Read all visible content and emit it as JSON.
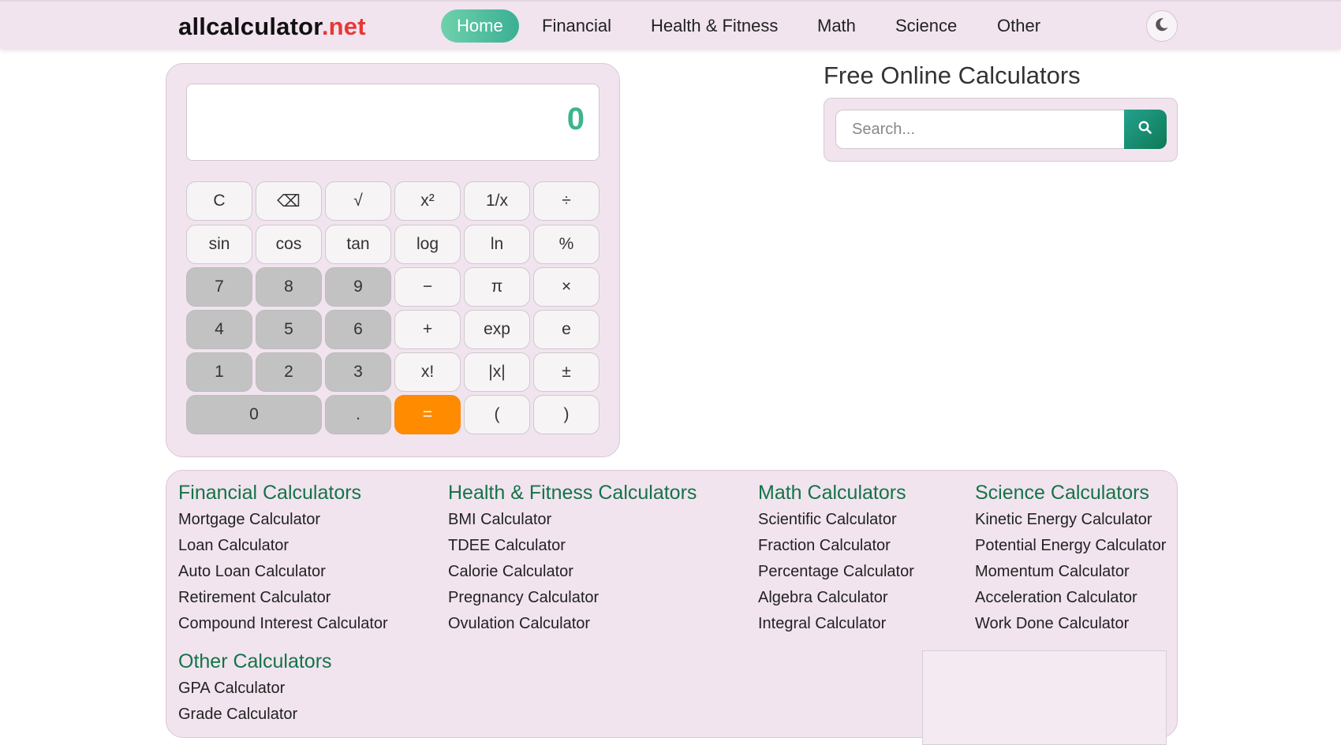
{
  "header": {
    "logo_main": "allcalculator",
    "logo_tld": ".net",
    "nav": [
      "Home",
      "Financial",
      "Health & Fitness",
      "Math",
      "Science",
      "Other"
    ],
    "theme_icon": "moon-icon"
  },
  "calculator": {
    "display_value": "0",
    "keys": [
      [
        "C",
        "⌫",
        "√",
        "x²",
        "1/x",
        "÷"
      ],
      [
        "sin",
        "cos",
        "tan",
        "log",
        "ln",
        "%"
      ],
      [
        "7",
        "8",
        "9",
        "−",
        "π",
        "×"
      ],
      [
        "4",
        "5",
        "6",
        "+",
        "exp",
        "e"
      ],
      [
        "1",
        "2",
        "3",
        "x!",
        "|x|",
        "±"
      ],
      [
        "0",
        ".",
        "=",
        "(",
        ")"
      ]
    ],
    "colors": {
      "display": "#3cb58e",
      "equals": "#ff8c00",
      "numeric_keys": "#c3c2c2"
    }
  },
  "search": {
    "title": "Free Online Calculators",
    "placeholder": "Search...",
    "button_icon": "search-icon"
  },
  "categories": [
    {
      "title": "Financial Calculators",
      "links": [
        "Mortgage Calculator",
        "Loan Calculator",
        "Auto Loan Calculator",
        "Retirement Calculator",
        "Compound Interest Calculator"
      ]
    },
    {
      "title": "Health & Fitness Calculators",
      "links": [
        "BMI Calculator",
        "TDEE Calculator",
        "Calorie Calculator",
        "Pregnancy Calculator",
        "Ovulation Calculator"
      ]
    },
    {
      "title": "Math Calculators",
      "links": [
        "Scientific Calculator",
        "Fraction Calculator",
        "Percentage Calculator",
        "Algebra Calculator",
        "Integral Calculator"
      ]
    },
    {
      "title": "Science Calculators",
      "links": [
        "Kinetic Energy Calculator",
        "Potential Energy Calculator",
        "Momentum Calculator",
        "Acceleration Calculator",
        "Work Done Calculator"
      ]
    },
    {
      "title": "Other Calculators",
      "links": [
        "GPA Calculator",
        "Grade Calculator"
      ]
    }
  ]
}
